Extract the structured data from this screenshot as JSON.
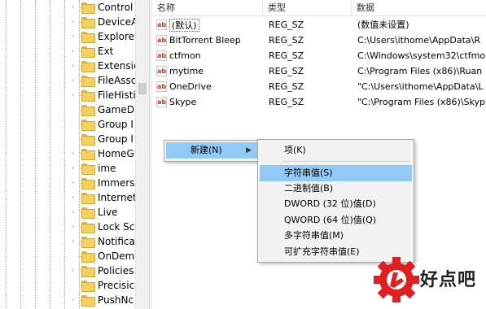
{
  "tree": {
    "items": [
      {
        "label": "Control",
        "expandable": true
      },
      {
        "label": "DeviceA",
        "expandable": true
      },
      {
        "label": "Explore",
        "expandable": true
      },
      {
        "label": "Ext",
        "expandable": true
      },
      {
        "label": "Extensic",
        "expandable": true
      },
      {
        "label": "FileAssc",
        "expandable": true
      },
      {
        "label": "FileHisti",
        "expandable": true
      },
      {
        "label": "GameD",
        "expandable": false
      },
      {
        "label": "Group I",
        "expandable": false
      },
      {
        "label": "Group I",
        "expandable": false
      },
      {
        "label": "HomeG",
        "expandable": true
      },
      {
        "label": "ime",
        "expandable": true
      },
      {
        "label": "Immers",
        "expandable": true
      },
      {
        "label": "Internet",
        "expandable": true
      },
      {
        "label": "Live",
        "expandable": true
      },
      {
        "label": "Lock Sc",
        "expandable": true
      },
      {
        "label": "Notifica",
        "expandable": true
      },
      {
        "label": "OnDem",
        "expandable": false
      },
      {
        "label": "Policies",
        "expandable": true
      },
      {
        "label": "Precisic",
        "expandable": false
      },
      {
        "label": "PushNc",
        "expandable": true
      }
    ]
  },
  "list": {
    "columns": [
      "名称",
      "类型",
      "数据"
    ],
    "rows": [
      {
        "name": "(默认)",
        "type": "REG_SZ",
        "data": "(数值未设置)"
      },
      {
        "name": "BitTorrent Bleep",
        "type": "REG_SZ",
        "data": "C:\\Users\\ithome\\AppData\\R"
      },
      {
        "name": "ctfmon",
        "type": "REG_SZ",
        "data": "C:\\Windows\\system32\\ctfmo"
      },
      {
        "name": "mytime",
        "type": "REG_SZ",
        "data": "C:\\Program Files (x86)\\Ruan"
      },
      {
        "name": "OneDrive",
        "type": "REG_SZ",
        "data": "\"C:\\Users\\ithome\\AppData\\L"
      },
      {
        "name": "Skype",
        "type": "REG_SZ",
        "data": "\"C:\\Program Files (x86)\\Skyp"
      }
    ],
    "value_icon": "ab"
  },
  "context_menu": {
    "new_label": "新建(N)",
    "submenu_arrow": "▶"
  },
  "submenu": {
    "items": [
      "项(K)",
      "字符串值(S)",
      "二进制值(B)",
      "DWORD (32 位)值(D)",
      "QWORD (64 位)值(Q)",
      "多字符串值(M)",
      "可扩充字符串值(E)"
    ],
    "highlighted_index": 1
  },
  "watermark": {
    "text": "好点吧",
    "colors": {
      "gear": "#e02020",
      "text": "#222222"
    }
  },
  "colors": {
    "menu_highlight": "#91c9f7",
    "menu_bg": "#f2f2f2",
    "folder": "#f4cf62"
  }
}
